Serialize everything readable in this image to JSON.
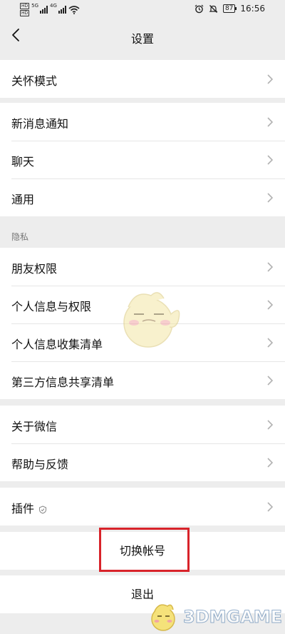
{
  "status_bar": {
    "hd_badges": [
      "HD",
      "HD"
    ],
    "net_1": "5G",
    "net_2": "4G",
    "battery": "87",
    "time": "16:56"
  },
  "header": {
    "title": "设置"
  },
  "groups": {
    "care": [
      "关怀模式"
    ],
    "general": [
      "新消息通知",
      "聊天",
      "通用"
    ],
    "privacy_label": "隐私",
    "privacy": [
      "朋友权限",
      "个人信息与权限",
      "个人信息收集清单",
      "第三方信息共享清单"
    ],
    "about": [
      "关于微信",
      "帮助与反馈"
    ],
    "plugins": [
      "插件"
    ]
  },
  "actions": {
    "switch_account": "切换帐号",
    "logout": "退出"
  },
  "watermark": {
    "text": "3DMGAME"
  },
  "colors": {
    "background": "#ededed",
    "highlight": "#d8232a",
    "divider": "#e6e6e6"
  },
  "icons": [
    "back-arrow-icon",
    "chevron-right-icon",
    "plugin-shield-icon",
    "wifi-icon",
    "mute-bell-icon",
    "alarm-icon",
    "battery-icon"
  ]
}
